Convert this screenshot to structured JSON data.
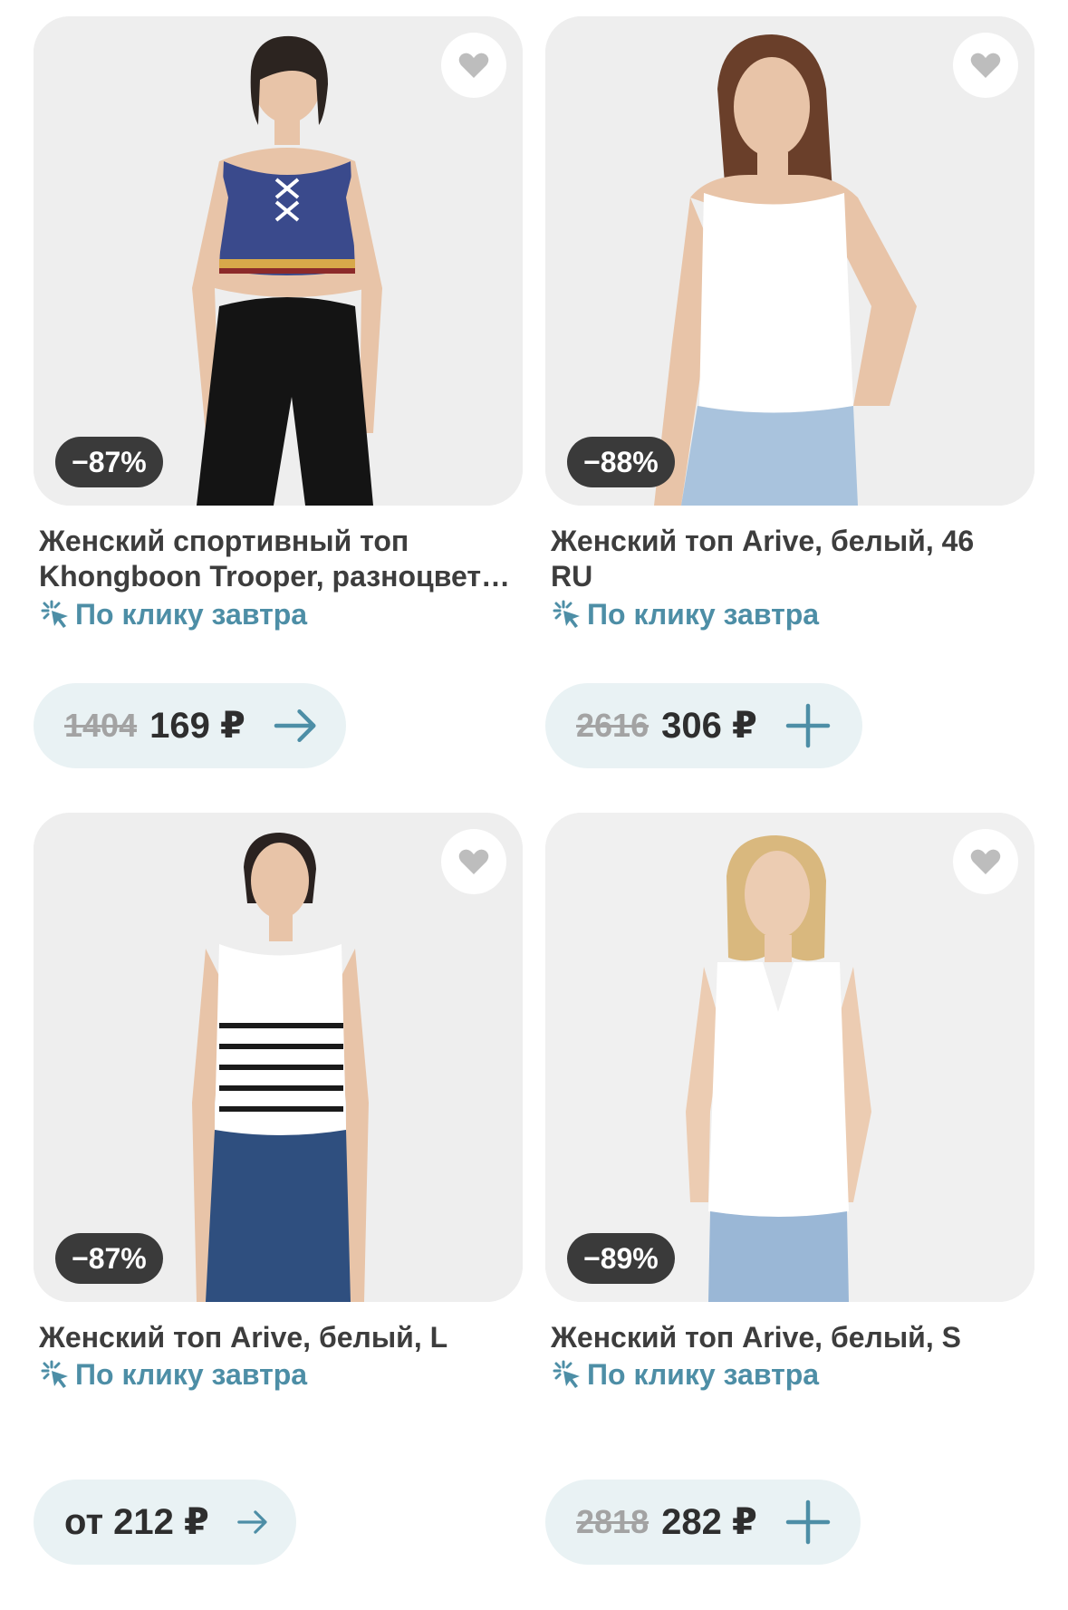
{
  "colors": {
    "accent": "#4d8ea6",
    "pill_bg": "#e9f2f4",
    "badge_bg": "#3a3a3a"
  },
  "products": [
    {
      "discount": "−87%",
      "title_line1": "Женский спортивный топ",
      "title_line2": "Khongboon Trooper, разноцветный",
      "delivery": "По клику завтра",
      "old_price": "1404",
      "price": "169 ₽",
      "action_icon": "arrow-right-icon"
    },
    {
      "discount": "−88%",
      "title_line1": "Женский топ Arive, белый, 46",
      "title_line2": "RU",
      "delivery": "По клику завтра",
      "old_price": "2616",
      "price": "306 ₽",
      "action_icon": "plus-icon"
    },
    {
      "discount": "−87%",
      "title_line1": "Женский топ Arive, белый, L",
      "title_line2": "",
      "delivery": "По клику завтра",
      "old_price": "",
      "price": "от 212 ₽",
      "action_icon": "arrow-right-icon"
    },
    {
      "discount": "−89%",
      "title_line1": "Женский топ Arive, белый, S",
      "title_line2": "",
      "delivery": "По клику завтра",
      "old_price": "2818",
      "price": "282 ₽",
      "action_icon": "plus-icon"
    }
  ]
}
